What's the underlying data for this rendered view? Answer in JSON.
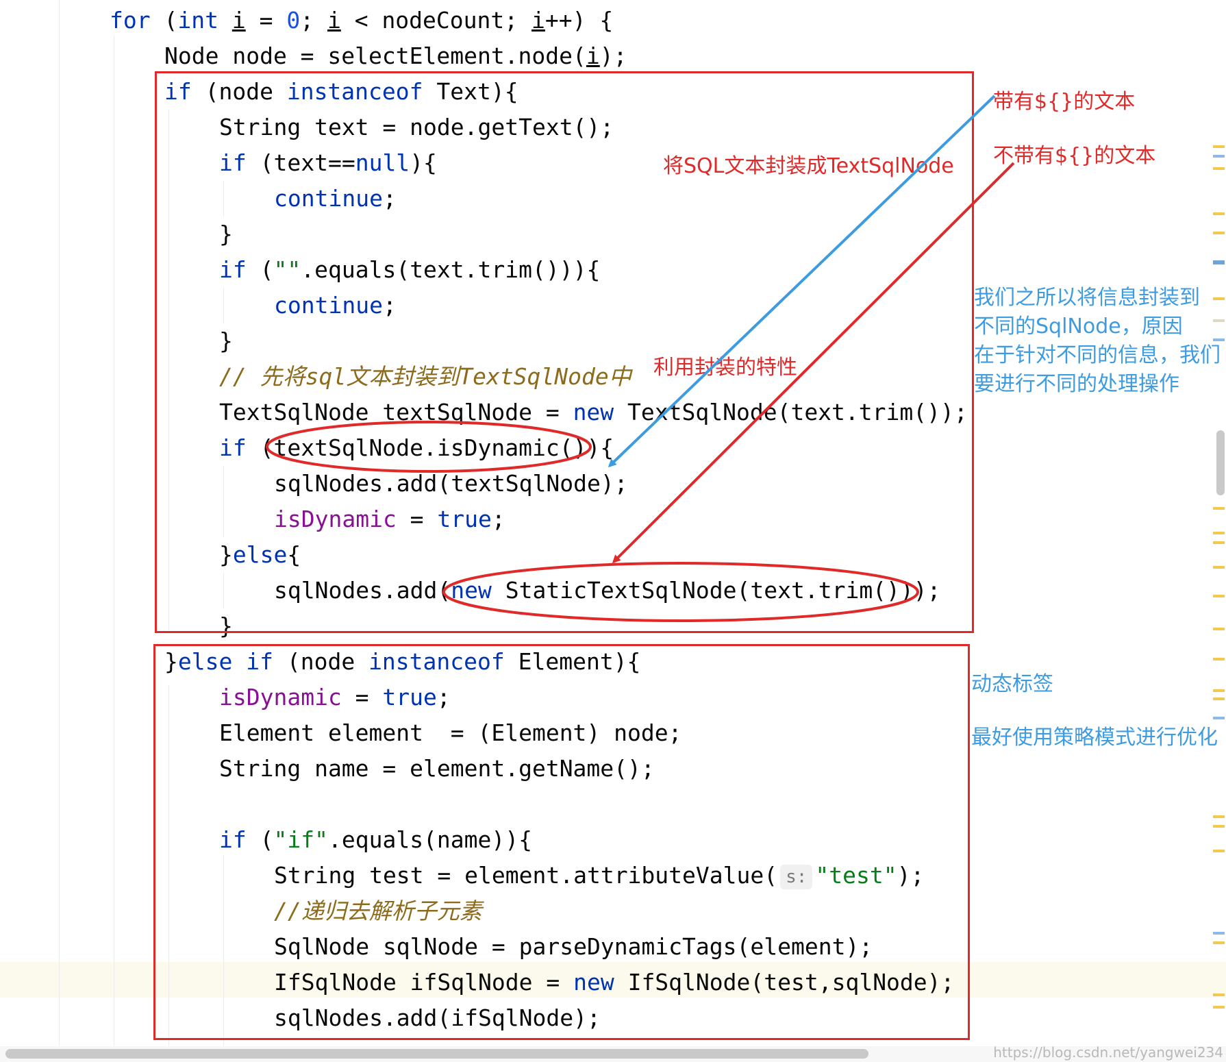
{
  "code": {
    "for_kw": "for",
    "for_open": " (",
    "int_kw": "int",
    "i_var": "i",
    "zero": "0",
    "for_cond": "nodeCount;",
    "for_close": "++) {",
    "line_node": "Node node = selectElement.node(",
    "line_node_end": ");",
    "if_kw": "if",
    "instanceof_kw": "instanceof",
    "if_text_a": " (node ",
    "if_text_b": " Text){",
    "string_text": "String text = node.getText();",
    "if_null_a": " (text==",
    "null_kw": "null",
    "if_null_b": "){",
    "continue_kw": "continue",
    "semicolon": ";",
    "close_brace": "}",
    "if_equals_a": " (",
    "empty_str": "\"\"",
    "if_equals_b": ".equals(text.trim())){",
    "comment_slash": "// ",
    "comment_text": "先将sql文本封装到TextSqlNode中",
    "textsqlnode_a": "TextSqlNode textSqlNode = ",
    "new_kw": "new",
    "textsqlnode_b": " TextSqlNode(text.trim());",
    "if_dynamic": " (textSqlNode.isDynamic()){",
    "add_textsqlnode": "sqlNodes.add(textSqlNode);",
    "isdynamic_field": "isDynamic",
    "true_kw": "true",
    "assign": " = ",
    "else_kw": "else",
    "else_open": "{",
    "add_static_a": "sqlNodes.add(",
    "add_static_b": " StaticTextSqlNode(text.trim()));",
    "elseif_a": " (node ",
    "elseif_b": " Element){",
    "element_cast": "Element element  = (Element) node;",
    "string_name": "String name = element.getName();",
    "if_str": "\"if\"",
    "if_name_b": ".equals(name)){",
    "string_test_a": "String test = element.attributeValue(",
    "param_hint": "s:",
    "test_str": "\"test\"",
    "string_test_b": ");",
    "recurse_comment": "//递归去解析子元素",
    "sqlnode_line": "SqlNode sqlNode = parseDynamicTags(element);",
    "ifsqlnode_a": "IfSqlNode ifSqlNode = ",
    "ifsqlnode_b": " IfSqlNode(test,sqlNode);",
    "add_ifsqlnode": "sqlNodes.add(ifSqlNode);"
  },
  "annotations": {
    "with_placeholder": "带有${}的文本",
    "without_placeholder": "不带有${}的文本",
    "wrap_sql": "将SQL文本封装成TextSqlNode",
    "use_wrap": "利用封装的特性",
    "reason_lines": [
      "我们之所以将信息封装到",
      "不同的SqlNode，原因",
      "在于针对不同的信息，我们",
      "要进行不同的处理操作"
    ],
    "dynamic_tag": "动态标签",
    "strategy": "最好使用策略模式进行优化"
  },
  "colors": {
    "annotation_red": "#e02a2a",
    "annotation_blue": "#3d9be0",
    "keyword": "#0033b3",
    "field": "#871094",
    "string": "#067d17"
  },
  "watermark": "https://blog.csdn.net/yangwei234"
}
